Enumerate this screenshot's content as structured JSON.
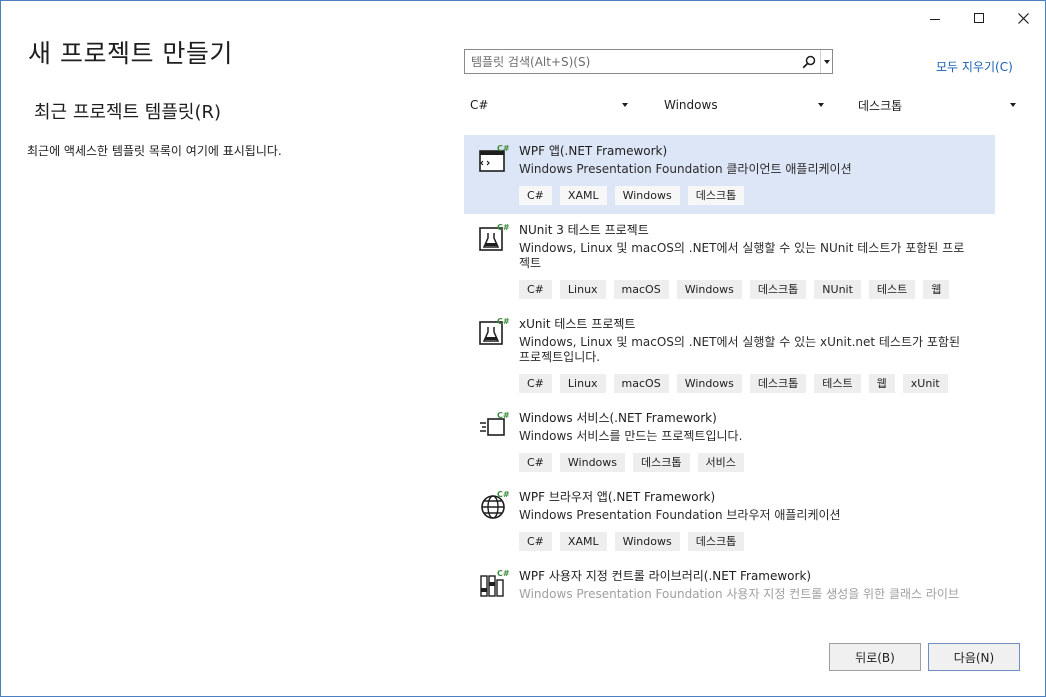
{
  "page": {
    "title": "새 프로젝트 만들기",
    "recent_heading": "최근 프로젝트 템플릿(R)",
    "recent_empty": "최근에 액세스한 템플릿 목록이 여기에 표시됩니다."
  },
  "search": {
    "placeholder": "템플릿 검색(Alt+S)(S)",
    "value": ""
  },
  "clear_all_label": "모두 지우기(C)",
  "filters": {
    "language": "C#",
    "platform": "Windows",
    "project_type": "데스크톱"
  },
  "templates": [
    {
      "title": "WPF 앱(.NET Framework)",
      "desc_lines": [
        "Windows Presentation Foundation 클라이언트 애플리케이션"
      ],
      "tags": [
        "C#",
        "XAML",
        "Windows",
        "데스크톱"
      ],
      "icon": "wpf-app-icon",
      "selected": true
    },
    {
      "title": "NUnit 3 테스트 프로젝트",
      "desc_lines": [
        "Windows, Linux 및 macOS의 .NET에서 실행할 수 있는 NUnit 테스트가 포함된 프로",
        "젝트"
      ],
      "tags": [
        "C#",
        "Linux",
        "macOS",
        "Windows",
        "데스크톱",
        "NUnit",
        "테스트",
        "웹"
      ],
      "icon": "test-flask-icon"
    },
    {
      "title": "xUnit 테스트 프로젝트",
      "desc_lines": [
        "Windows, Linux 및 macOS의 .NET에서 실행할 수 있는 xUnit.net 테스트가 포함된",
        "프로젝트입니다."
      ],
      "tags": [
        "C#",
        "Linux",
        "macOS",
        "Windows",
        "데스크톱",
        "테스트",
        "웹",
        "xUnit"
      ],
      "icon": "test-flask-icon"
    },
    {
      "title": "Windows 서비스(.NET Framework)",
      "desc_lines": [
        "Windows 서비스를 만드는 프로젝트입니다."
      ],
      "tags": [
        "C#",
        "Windows",
        "데스크톱",
        "서비스"
      ],
      "icon": "windows-service-icon"
    },
    {
      "title": "WPF 브라우저 앱(.NET Framework)",
      "desc_lines": [
        "Windows Presentation Foundation 브라우저 애플리케이션"
      ],
      "tags": [
        "C#",
        "XAML",
        "Windows",
        "데스크톱"
      ],
      "icon": "globe-icon"
    },
    {
      "title": "WPF 사용자 지정 컨트롤 라이브러리(.NET Framework)",
      "desc_lines": [
        "Windows Presentation Foundation 사용자 지정 컨트롤 생성을 위한 클래스 라이브"
      ],
      "tags": [],
      "icon": "control-library-icon",
      "faded": true
    }
  ],
  "footer": {
    "back_label": "뒤로(B)",
    "next_label": "다음(N)"
  },
  "colors": {
    "accent_green": "#3c8a3c",
    "selected_bg": "#dde6f7",
    "link": "#1a5fb4"
  }
}
